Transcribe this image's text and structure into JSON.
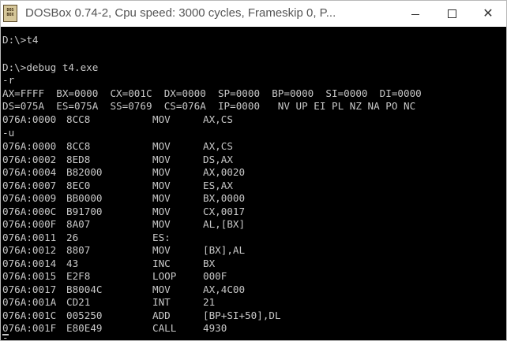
{
  "window": {
    "title": "DOSBox 0.74-2, Cpu speed:      3000 cycles, Frameskip  0, P...",
    "icon": "dosbox-icon",
    "icon_text": "DOS BOX",
    "controls": {
      "minimize_icon": "minimize-icon",
      "maximize_icon": "maximize-icon",
      "close_icon": "close-icon",
      "close_glyph": "✕"
    }
  },
  "console": {
    "prompt_lines": [
      "D:\\>t4",
      "",
      "D:\\>debug t4.exe",
      "-r"
    ],
    "registers_1": "AX=FFFF  BX=0000  CX=001C  DX=0000  SP=0000  BP=0000  SI=0000  DI=0000",
    "registers_2": "DS=075A  ES=075A  SS=0769  CS=076A  IP=0000   NV UP EI PL NZ NA PO NC",
    "current_instr": {
      "addr": "076A:0000",
      "hex": "8CC8",
      "op": "MOV",
      "args": "AX,CS"
    },
    "u_command": "-u",
    "listing": [
      {
        "addr": "076A:0000",
        "hex": "8CC8",
        "op": "MOV",
        "args": "AX,CS"
      },
      {
        "addr": "076A:0002",
        "hex": "8ED8",
        "op": "MOV",
        "args": "DS,AX"
      },
      {
        "addr": "076A:0004",
        "hex": "B82000",
        "op": "MOV",
        "args": "AX,0020"
      },
      {
        "addr": "076A:0007",
        "hex": "8EC0",
        "op": "MOV",
        "args": "ES,AX"
      },
      {
        "addr": "076A:0009",
        "hex": "BB0000",
        "op": "MOV",
        "args": "BX,0000"
      },
      {
        "addr": "076A:000C",
        "hex": "B91700",
        "op": "MOV",
        "args": "CX,0017"
      },
      {
        "addr": "076A:000F",
        "hex": "8A07",
        "op": "MOV",
        "args": "AL,[BX]"
      },
      {
        "addr": "076A:0011",
        "hex": "26",
        "op": "ES:",
        "args": ""
      },
      {
        "addr": "076A:0012",
        "hex": "8807",
        "op": "MOV",
        "args": "[BX],AL"
      },
      {
        "addr": "076A:0014",
        "hex": "43",
        "op": "INC",
        "args": "BX"
      },
      {
        "addr": "076A:0015",
        "hex": "E2F8",
        "op": "LOOP",
        "args": "000F"
      },
      {
        "addr": "076A:0017",
        "hex": "B8004C",
        "op": "MOV",
        "args": "AX,4C00"
      },
      {
        "addr": "076A:001A",
        "hex": "CD21",
        "op": "INT",
        "args": "21"
      },
      {
        "addr": "076A:001C",
        "hex": "005250",
        "op": "ADD",
        "args": "[BP+SI+50],DL"
      },
      {
        "addr": "076A:001F",
        "hex": "E80E49",
        "op": "CALL",
        "args": "4930"
      }
    ],
    "final_prompt": "-"
  }
}
